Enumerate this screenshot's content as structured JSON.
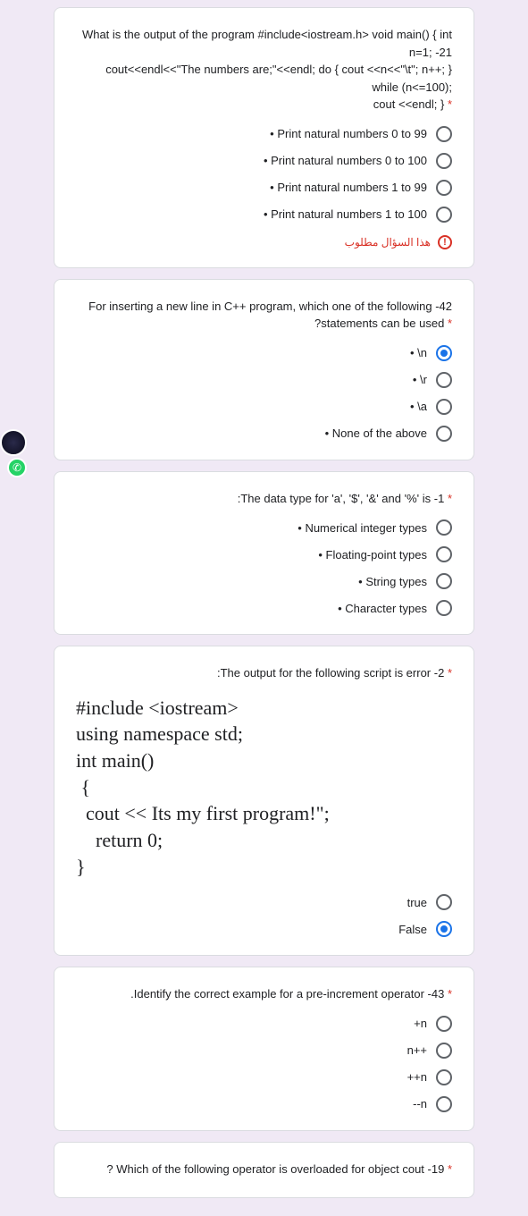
{
  "q1": {
    "text_p1": "What is the output of the program #include<iostream.h> void main() { int n=1; -21",
    "text_p2": "cout<<endl<<\"The numbers are;\"<<endl; do { cout <<n<<\"\\t\"; n++; } while (n<=100);",
    "text_p3": "cout <<endl; }",
    "opts": [
      "Print natural numbers 0 to 99",
      "Print natural numbers 0 to 100",
      "Print natural numbers 1 to 99",
      "Print natural numbers 1 to 100"
    ],
    "required": "هذا السؤال مطلوب"
  },
  "q2": {
    "text_p1": "For inserting a new line in C++ program, which one of the following -42",
    "text_p2": "?statements can be used",
    "opts": [
      "\\n",
      "\\r",
      "\\a",
      "None of the above"
    ],
    "selected": 0
  },
  "q3": {
    "text": ":The data type for 'a', '$', '&' and '%' is -1",
    "opts": [
      "Numerical integer types",
      "Floating-point types",
      "String types",
      "Character types"
    ]
  },
  "q4": {
    "text": ":The output for the following script is error -2",
    "code": "#include <iostream>\nusing namespace std;\nint main()\n {\n  cout << Its my first program!\";\n    return 0;\n}",
    "opts": [
      "true",
      "False"
    ],
    "selected": 1
  },
  "q5": {
    "text": ".Identify the correct example for a pre-increment operator -43",
    "opts": [
      "+n",
      "n++",
      "++n",
      "--n"
    ]
  },
  "q6": {
    "text": "? Which of the following operator is overloaded for object cout -19"
  }
}
